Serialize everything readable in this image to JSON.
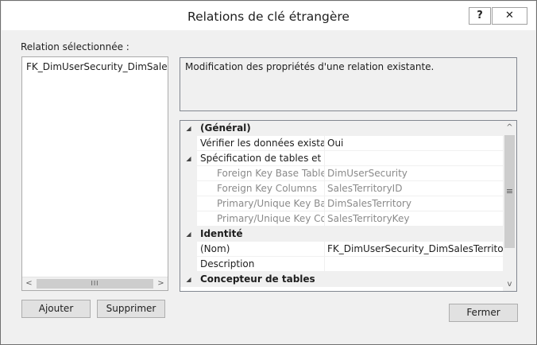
{
  "window": {
    "title": "Relations de clé étrangère",
    "help_label": "?",
    "close_label": "✕"
  },
  "selected_relation": {
    "label": "Relation sélectionnée :",
    "items": [
      "FK_DimUserSecurity_DimSalesTerritory"
    ]
  },
  "description": "Modification des propriétés d'une relation existante.",
  "property_grid": {
    "rows": [
      {
        "type": "category",
        "expander": "◢",
        "name": "(Général)"
      },
      {
        "type": "prop",
        "expander": "",
        "name": "Vérifier les données existantes",
        "value": "Oui"
      },
      {
        "type": "prop",
        "expander": "◢",
        "name": "Spécification de tables et de",
        "value": ""
      },
      {
        "type": "sub",
        "expander": "",
        "name": "Foreign Key Base Table",
        "value": "DimUserSecurity"
      },
      {
        "type": "sub",
        "expander": "",
        "name": "Foreign Key Columns",
        "value": "SalesTerritoryID"
      },
      {
        "type": "sub",
        "expander": "",
        "name": "Primary/Unique Key Base",
        "value": "DimSalesTerritory"
      },
      {
        "type": "sub",
        "expander": "",
        "name": "Primary/Unique Key Columns",
        "value": "SalesTerritoryKey"
      },
      {
        "type": "category",
        "expander": "◢",
        "name": "Identité"
      },
      {
        "type": "prop",
        "expander": "",
        "name": "(Nom)",
        "value": "FK_DimUserSecurity_DimSalesTerritory"
      },
      {
        "type": "prop",
        "expander": "",
        "name": "Description",
        "value": ""
      },
      {
        "type": "category",
        "expander": "◢",
        "name": "Concepteur de tables"
      }
    ]
  },
  "buttons": {
    "add": "Ajouter",
    "delete": "Supprimer",
    "close": "Fermer"
  },
  "scroll_glyphs": {
    "left": "<",
    "right": ">",
    "up": "^",
    "down": "v",
    "grip_h": "III",
    "grip_v": "≡"
  }
}
